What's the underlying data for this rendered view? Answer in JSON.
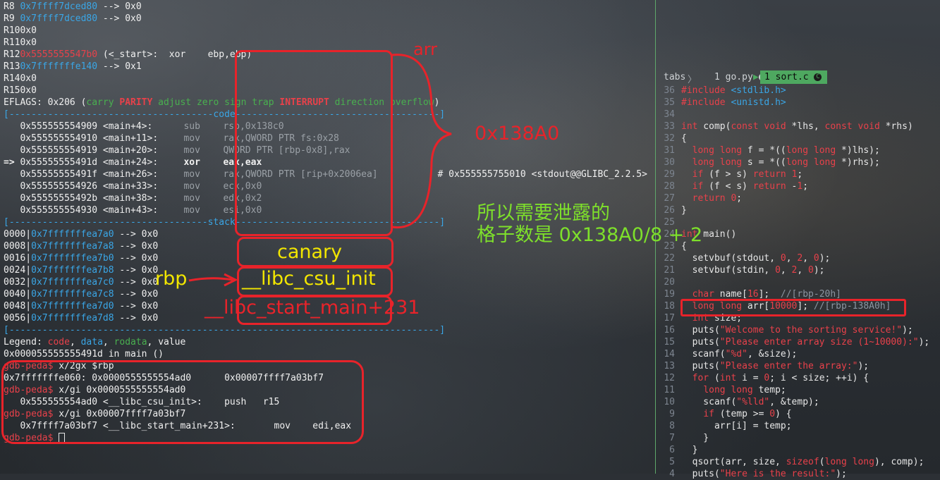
{
  "registers": [
    {
      "name": "R8 ",
      "value": "0x7ffff7dced80",
      "rest": " --> 0x0",
      "color": "cyan"
    },
    {
      "name": "R9 ",
      "value": "0x7ffff7dced80",
      "rest": " --> 0x0",
      "color": "cyan"
    },
    {
      "name": "R10",
      "value": "",
      "rest": "0x0",
      "color": "white"
    },
    {
      "name": "R11",
      "value": "",
      "rest": "0x0",
      "color": "white"
    },
    {
      "name": "R12",
      "value": "0x5555555547b0",
      "rest": " (<_start>:  xor    ebp,ebp)",
      "color": "red"
    },
    {
      "name": "R13",
      "value": "0x7fffffffe140",
      "rest": " --> 0x1",
      "color": "cyan"
    },
    {
      "name": "R14",
      "value": "",
      "rest": "0x0",
      "color": "white"
    },
    {
      "name": "R15",
      "value": "",
      "rest": "0x0",
      "color": "white"
    }
  ],
  "eflags": {
    "prefix": "EFLAGS: 0x206 (",
    "flags": [
      {
        "t": "carry",
        "c": "green"
      },
      {
        "t": " ",
        "c": "white"
      },
      {
        "t": "PARITY",
        "c": "red"
      },
      {
        "t": " ",
        "c": "white"
      },
      {
        "t": "adjust",
        "c": "green"
      },
      {
        "t": " ",
        "c": "white"
      },
      {
        "t": "zero",
        "c": "green"
      },
      {
        "t": " ",
        "c": "white"
      },
      {
        "t": "sign",
        "c": "green"
      },
      {
        "t": " ",
        "c": "white"
      },
      {
        "t": "trap",
        "c": "green"
      },
      {
        "t": " ",
        "c": "white"
      },
      {
        "t": "INTERRUPT",
        "c": "red"
      },
      {
        "t": " ",
        "c": "white"
      },
      {
        "t": "direction",
        "c": "green"
      },
      {
        "t": " ",
        "c": "white"
      },
      {
        "t": "overflow",
        "c": "green"
      }
    ],
    "suffix": ")"
  },
  "code_sep": "[-------------------------------------code-------------------------------------]",
  "code_lines": [
    {
      "prefix": "   ",
      "addr": "0x555555554909 <main+4>:",
      "op": "sub",
      "args": "rsp,0x138c0",
      "comment": "",
      "current": false
    },
    {
      "prefix": "   ",
      "addr": "0x555555554910 <main+11>:",
      "op": "mov",
      "args": "rax,QWORD PTR fs:0x28",
      "comment": "",
      "current": false
    },
    {
      "prefix": "   ",
      "addr": "0x555555554919 <main+20>:",
      "op": "mov",
      "args": "QWORD PTR [rbp-0x8],rax",
      "comment": "",
      "current": false
    },
    {
      "prefix": "=> ",
      "addr": "0x55555555491d <main+24>:",
      "op": "xor",
      "args": "eax,eax",
      "comment": "",
      "current": true
    },
    {
      "prefix": "   ",
      "addr": "0x55555555491f <main+26>:",
      "op": "mov",
      "args": "rax,QWORD PTR [rip+0x2006ea]",
      "comment": "# 0x555555755010 <stdout@@GLIBC_2.2.5>",
      "current": false
    },
    {
      "prefix": "   ",
      "addr": "0x555555554926 <main+33>:",
      "op": "mov",
      "args": "ecx,0x0",
      "comment": "",
      "current": false
    },
    {
      "prefix": "   ",
      "addr": "0x55555555492b <main+38>:",
      "op": "mov",
      "args": "edx,0x2",
      "comment": "",
      "current": false
    },
    {
      "prefix": "   ",
      "addr": "0x555555554930 <main+43>:",
      "op": "mov",
      "args": "esi,0x0",
      "comment": "",
      "current": false
    }
  ],
  "stack_sep": "[------------------------------------stack-------------------------------------]",
  "stack_lines": [
    {
      "off": "0000|",
      "addr": "0x7fffffffea7a0",
      "rest": " --> 0x0"
    },
    {
      "off": "0008|",
      "addr": "0x7fffffffea7a8",
      "rest": " --> 0x0"
    },
    {
      "off": "0016|",
      "addr": "0x7fffffffea7b0",
      "rest": " --> 0x0"
    },
    {
      "off": "0024|",
      "addr": "0x7fffffffea7b8",
      "rest": " --> 0x0"
    },
    {
      "off": "0032|",
      "addr": "0x7fffffffea7c0",
      "rest": " --> 0x0"
    },
    {
      "off": "0040|",
      "addr": "0x7fffffffea7c8",
      "rest": " --> 0x0"
    },
    {
      "off": "0048|",
      "addr": "0x7fffffffea7d0",
      "rest": " --> 0x0"
    },
    {
      "off": "0056|",
      "addr": "0x7fffffffea7d8",
      "rest": " --> 0x0"
    }
  ],
  "end_sep": "[------------------------------------------------------------------------------]",
  "legend": {
    "label": "Legend: ",
    "code": "code",
    "data": "data",
    "rodata": "rodata",
    "value": "value"
  },
  "location": "0x000055555555491d in main ()",
  "session": [
    {
      "type": "prompt",
      "prompt": "gdb-peda$ ",
      "cmd": "x/2gx $rbp"
    },
    {
      "type": "out",
      "text": "0x7fffffffe060: 0x0000555555554ad0      0x00007ffff7a03bf7"
    },
    {
      "type": "prompt",
      "prompt": "gdb-peda$ ",
      "cmd": "x/gi 0x0000555555554ad0"
    },
    {
      "type": "out",
      "text": "   0x555555554ad0 <__libc_csu_init>:    push   r15"
    },
    {
      "type": "prompt",
      "prompt": "gdb-peda$ ",
      "cmd": "x/gi 0x00007ffff7a03bf7"
    },
    {
      "type": "out",
      "text": "   0x7ffff7a03bf7 <__libc_start_main+231>:       mov    edi,eax"
    },
    {
      "type": "prompt",
      "prompt": "gdb-peda$ ",
      "cmd": ""
    }
  ],
  "annotations": {
    "arr": "arr",
    "size": "0x138A0",
    "note_line1": "所以需要泄露的",
    "note_line2": "格子数是 0x138A0/8 + 2",
    "canary": "canary",
    "rbp": "rbp",
    "csu": "__libc_csu_init",
    "start_main": "__libc_start_main+231"
  },
  "editor": {
    "tabs_label": "tabs",
    "tab1": "1 go.py",
    "tab2": "1 sort.c",
    "lines": [
      {
        "n": "36",
        "html": "<span class=\"kw\">#include</span> <span class=\"inc\">&lt;stdlib.h&gt;</span>"
      },
      {
        "n": "35",
        "html": "<span class=\"kw\">#include</span> <span class=\"inc\">&lt;unistd.h&gt;</span>"
      },
      {
        "n": "34",
        "html": ""
      },
      {
        "n": "33",
        "html": "<span class=\"kw\">int</span> comp(<span class=\"kw\">const</span> <span class=\"kw\">void</span> *lhs, <span class=\"kw\">const</span> <span class=\"kw\">void</span> *rhs)"
      },
      {
        "n": "32",
        "html": "{"
      },
      {
        "n": "31",
        "html": "  <span class=\"kw\">long long</span> f = *((<span class=\"kw\">long long</span> *)lhs);"
      },
      {
        "n": "30",
        "html": "  <span class=\"kw\">long long</span> s = *((<span class=\"kw\">long long</span> *)rhs);"
      },
      {
        "n": "29",
        "html": "  <span class=\"kw\">if</span> (f &gt; s) <span class=\"kw\">return</span> <span class=\"num\">1</span>;"
      },
      {
        "n": "28",
        "html": "  <span class=\"kw\">if</span> (f &lt; s) <span class=\"kw\">return</span> -<span class=\"num\">1</span>;"
      },
      {
        "n": "27",
        "html": "  <span class=\"kw\">return</span> <span class=\"num\">0</span>;"
      },
      {
        "n": "26",
        "html": "}"
      },
      {
        "n": "25",
        "html": ""
      },
      {
        "n": "24",
        "html": "<span class=\"kw\">int</span> main()"
      },
      {
        "n": "23",
        "html": "{"
      },
      {
        "n": "22",
        "html": "  setvbuf(stdout, <span class=\"num\">0</span>, <span class=\"num\">2</span>, <span class=\"num\">0</span>);"
      },
      {
        "n": "21",
        "html": "  setvbuf(stdin, <span class=\"num\">0</span>, <span class=\"num\">2</span>, <span class=\"num\">0</span>);"
      },
      {
        "n": "20",
        "html": ""
      },
      {
        "n": "19",
        "html": "  <span class=\"kw\">char</span> name[<span class=\"num\">16</span>];  <span class=\"cm\">//[rbp-20h]</span>"
      },
      {
        "n": "18",
        "html": "  <span class=\"kw\">long long</span> arr[<span class=\"num\">10000</span>]; <span class=\"cm\">//[rbp-138A0h]</span>"
      },
      {
        "n": "17",
        "html": "  <span class=\"kw\">int</span> size;"
      },
      {
        "n": "16",
        "html": "  puts(<span class=\"str\">\"Welcome to the sorting service!\"</span>);"
      },
      {
        "n": "15",
        "html": "  puts(<span class=\"str\">\"Please enter array size (1~10000):\"</span>);"
      },
      {
        "n": "14",
        "html": "  scanf(<span class=\"str\">\"%d\"</span>, &amp;size);"
      },
      {
        "n": "13",
        "html": "  puts(<span class=\"str\">\"Please enter the array:\"</span>);"
      },
      {
        "n": "12",
        "html": "  <span class=\"kw\">for</span> (<span class=\"kw\">int</span> i = <span class=\"num\">0</span>; i &lt; size; ++i) {"
      },
      {
        "n": "11",
        "html": "    <span class=\"kw\">long long</span> temp;"
      },
      {
        "n": "10",
        "html": "    scanf(<span class=\"str\">\"%lld\"</span>, &amp;temp);"
      },
      {
        "n": "9",
        "html": "    <span class=\"kw\">if</span> (temp &gt;= <span class=\"num\">0</span>) {"
      },
      {
        "n": "8",
        "html": "      arr[i] = temp;"
      },
      {
        "n": "7",
        "html": "    }"
      },
      {
        "n": "6",
        "html": "  }"
      },
      {
        "n": "5",
        "html": "  qsort(arr, size, <span class=\"kw\">sizeof</span>(<span class=\"kw\">long long</span>), comp);"
      },
      {
        "n": "4",
        "html": "  puts(<span class=\"str\">\"Here is the result:\"</span>);"
      }
    ]
  },
  "colors": {
    "annotation_red": "#e8232a",
    "annotation_green": "#7ee02b",
    "canary_yellow": "#f2e600",
    "accent_green": "#4ea860"
  }
}
